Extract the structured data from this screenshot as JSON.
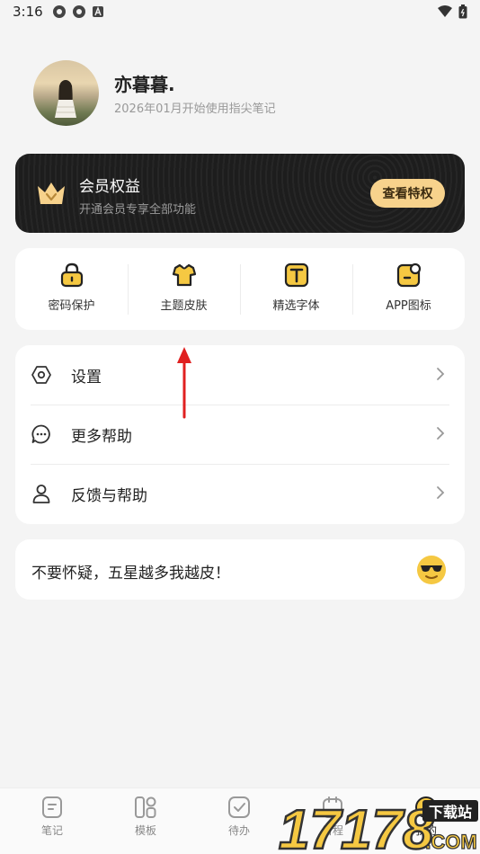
{
  "status_bar": {
    "time": "3:16"
  },
  "profile": {
    "username": "亦暮暮.",
    "since": "2026年01月开始使用指尖笔记"
  },
  "vip": {
    "title": "会员权益",
    "subtitle": "开通会员专享全部功能",
    "button": "查看特权"
  },
  "features": [
    {
      "label": "密码保护",
      "icon": "lock-icon"
    },
    {
      "label": "主题皮肤",
      "icon": "shirt-icon"
    },
    {
      "label": "精选字体",
      "icon": "font-icon"
    },
    {
      "label": "APP图标",
      "icon": "app-icon"
    }
  ],
  "menu": [
    {
      "label": "设置",
      "icon": "settings-icon"
    },
    {
      "label": "更多帮助",
      "icon": "chat-icon"
    },
    {
      "label": "反馈与帮助",
      "icon": "person-icon"
    }
  ],
  "slogan": {
    "text": "不要怀疑，五星越多我越皮！",
    "icon": "cool-face-icon"
  },
  "bottom_nav": [
    {
      "label": "笔记",
      "icon": "note-icon"
    },
    {
      "label": "模板",
      "icon": "template-icon"
    },
    {
      "label": "待办",
      "icon": "todo-icon"
    },
    {
      "label": "日程",
      "icon": "calendar-icon"
    },
    {
      "label": "我的",
      "icon": "profile-icon"
    }
  ],
  "watermark": {
    "text": "17178",
    "suffix": "下载站",
    "domain": ".COM"
  },
  "colors": {
    "accent": "#f5c842",
    "vip_gold": "#f7d28c",
    "annotation_red": "#e02020"
  }
}
